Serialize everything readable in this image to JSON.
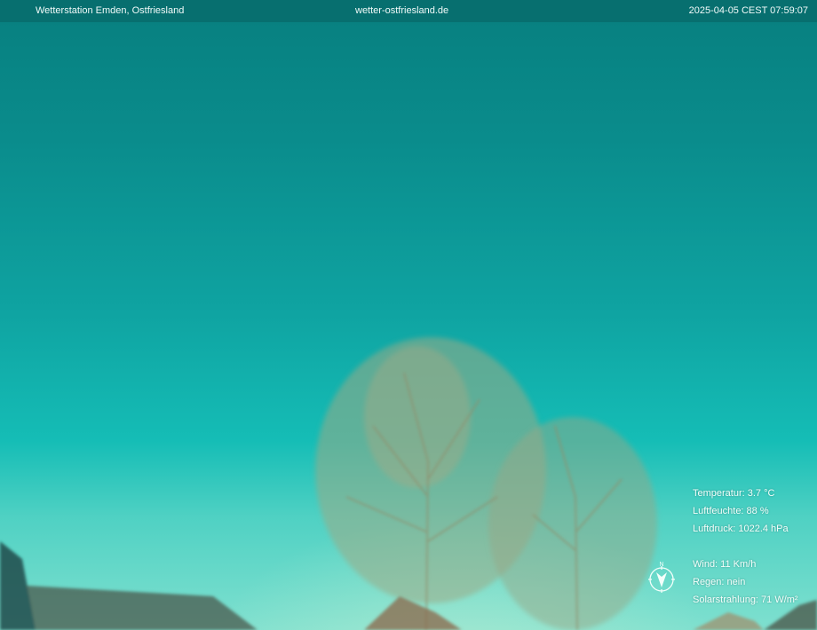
{
  "header": {
    "station": "Wetterstation Emden, Ostfriesland",
    "website": "wetter-ostfriesland.de",
    "timestamp": "2025-04-05 CEST 07:59:07"
  },
  "weather": {
    "temperature": "Temperatur: 3.7 °C",
    "humidity": "Luftfeuchte: 88 %",
    "pressure": "Luftdruck: 1022.4 hPa",
    "wind": "Wind: 11 Km/h",
    "rain": "Regen: nein",
    "solar": "Solarstrahlung: 71 W/m²"
  },
  "compass": {
    "north_label": "N",
    "icon": "compass-icon"
  },
  "colors": {
    "sky_top": "#077f7f",
    "sky_bottom": "#7fe0cf",
    "text": "#f3fffb"
  }
}
